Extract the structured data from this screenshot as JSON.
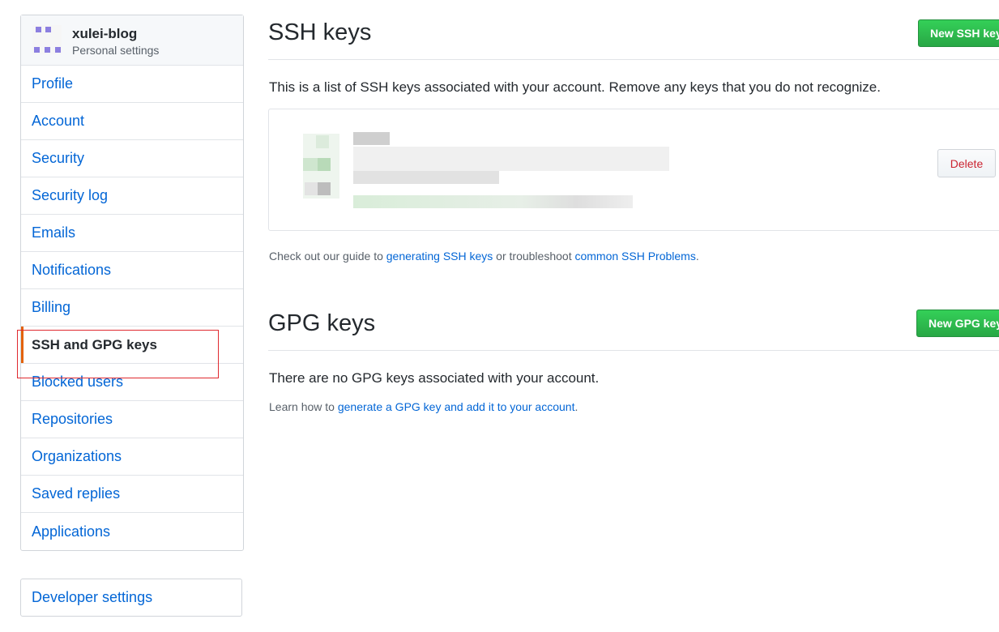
{
  "user": {
    "name": "xulei-blog",
    "subtitle": "Personal settings"
  },
  "sidebar": {
    "items": [
      {
        "label": "Profile"
      },
      {
        "label": "Account"
      },
      {
        "label": "Security"
      },
      {
        "label": "Security log"
      },
      {
        "label": "Emails"
      },
      {
        "label": "Notifications"
      },
      {
        "label": "Billing"
      },
      {
        "label": "SSH and GPG keys",
        "selected": true
      },
      {
        "label": "Blocked users"
      },
      {
        "label": "Repositories"
      },
      {
        "label": "Organizations"
      },
      {
        "label": "Saved replies"
      },
      {
        "label": "Applications"
      }
    ],
    "developer_settings": "Developer settings"
  },
  "ssh": {
    "title": "SSH keys",
    "new_button": "New SSH key",
    "description": "This is a list of SSH keys associated with your account. Remove any keys that you do not recognize.",
    "delete_button": "Delete",
    "guide_prefix": "Check out our guide to ",
    "guide_link1": "generating SSH keys",
    "guide_middle": " or troubleshoot ",
    "guide_link2": "common SSH Problems",
    "guide_suffix": "."
  },
  "gpg": {
    "title": "GPG keys",
    "new_button": "New GPG key",
    "empty_text": "There are no GPG keys associated with your account.",
    "learn_prefix": "Learn how to ",
    "learn_link": "generate a GPG key and add it to your account",
    "learn_suffix": "."
  },
  "colors": {
    "link": "#0366d6",
    "primary_button": "#28a745",
    "selected_indicator": "#e36209",
    "delete_text": "#cb2431",
    "annotation_box": "#e0292f"
  }
}
